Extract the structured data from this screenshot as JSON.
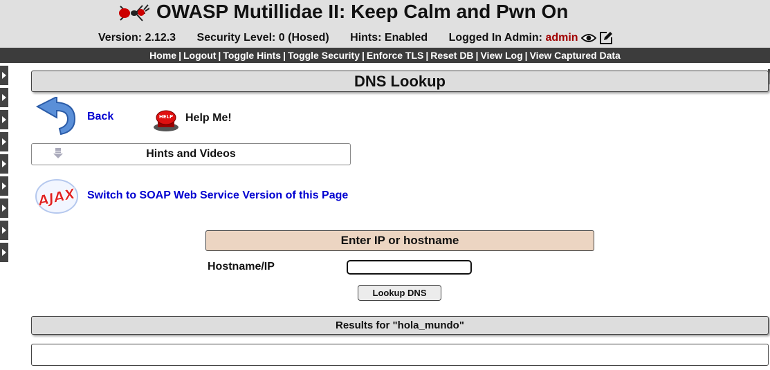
{
  "app": {
    "title": "OWASP Mutillidae II: Keep Calm and Pwn On"
  },
  "status": {
    "version": "Version: 2.12.3",
    "security_level": "Security Level: 0 (Hosed)",
    "hints": "Hints: Enabled",
    "logged_in_prefix": "Logged In Admin:",
    "admin_name": "admin"
  },
  "nav": {
    "items": [
      "Home",
      "Logout",
      "Toggle Hints",
      "Toggle Security",
      "Enforce TLS",
      "Reset DB",
      "View Log",
      "View Captured Data"
    ]
  },
  "page": {
    "title": "DNS Lookup",
    "back_label": "Back",
    "help_label": "Help Me!",
    "help_badge": "HELP",
    "hints_label": "Hints and Videos",
    "ajax_badge": "AJAX",
    "ajax_label": "Switch to SOAP Web Service Version of this Page"
  },
  "form": {
    "header": "Enter IP or hostname",
    "field_label": "Hostname/IP",
    "field_value": "",
    "button_label": "Lookup DNS"
  },
  "results": {
    "header": "Results for \"hola_mundo\"",
    "content": ""
  },
  "colors": {
    "header_bg": "#e0e0e0",
    "navbar_bg": "#3c3c3c",
    "link_blue": "#0000d0",
    "admin_red": "#a00000",
    "form_header_bg": "#ecd5c2",
    "section_bar_bg": "#dddddd"
  },
  "icons": {
    "logo": "ant-logo-icon",
    "view_profile": "eye-icon",
    "edit_profile": "edit-icon",
    "back": "back-arrow-icon",
    "help": "help-button-icon",
    "hints_toggle": "down-arrow-icon",
    "ajax": "ajax-logo-icon"
  }
}
